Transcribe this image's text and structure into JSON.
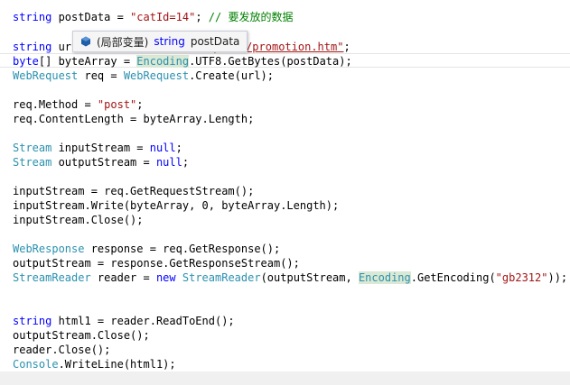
{
  "code": {
    "line1": {
      "t1": "string",
      "t2": " postData = ",
      "t3": "\"catId=14\"",
      "t4": "; ",
      "t5": "// 要发放的数据"
    },
    "line2": {
      "t1": "string",
      "t2": " ur",
      "t3": "m/keyword/promotion.htm\"",
      "t4": ";"
    },
    "line3": {
      "t1": "byte",
      "t2": "[] byteArray = ",
      "t3": "Encoding",
      "t4": ".UTF8.GetBytes(postData);"
    },
    "line4": {
      "t1": "WebRequest",
      "t2": " req = ",
      "t3": "WebRequest",
      "t4": ".Create(url);"
    },
    "line5": {
      "t1": "req.Method = ",
      "t2": "\"post\"",
      "t3": ";"
    },
    "line6": {
      "t1": "req.ContentLength = byteArray.Length;"
    },
    "line7": {
      "t1": "Stream",
      "t2": " inputStream = ",
      "t3": "null",
      "t4": ";"
    },
    "line8": {
      "t1": "Stream",
      "t2": " outputStream = ",
      "t3": "null",
      "t4": ";"
    },
    "line9": {
      "t1": "inputStream = req.GetRequestStream();"
    },
    "line10": {
      "t1": "inputStream.Write(byteArray, 0, byteArray.Length);"
    },
    "line11": {
      "t1": "inputStream.Close();"
    },
    "line12": {
      "t1": "WebResponse",
      "t2": " response = req.GetResponse();"
    },
    "line13": {
      "t1": "outputStream = response.GetResponseStream();"
    },
    "line14": {
      "t1": "StreamReader",
      "t2": " reader = ",
      "t3": "new",
      "t4": " ",
      "t5": "StreamReader",
      "t6": "(outputStream, ",
      "t7": "Encoding",
      "t8": ".GetEncoding(",
      "t9": "\"gb2312\"",
      "t10": "));"
    },
    "line15": {
      "t1": "string",
      "t2": " html1 = reader.ReadToEnd();"
    },
    "line16": {
      "t1": "outputStream.Close();"
    },
    "line17": {
      "t1": "reader.Close();"
    },
    "line18": {
      "t1": "Console",
      "t2": ".WriteLine(html1);"
    }
  },
  "tooltip": {
    "icon": "local-variable-icon",
    "scope": "(局部变量)",
    "type": "string",
    "name": "postData"
  },
  "colors": {
    "keyword": "#0000ff",
    "type": "#2b91af",
    "string": "#a31515",
    "comment": "#008000",
    "highlight": "#dbe9d4"
  }
}
